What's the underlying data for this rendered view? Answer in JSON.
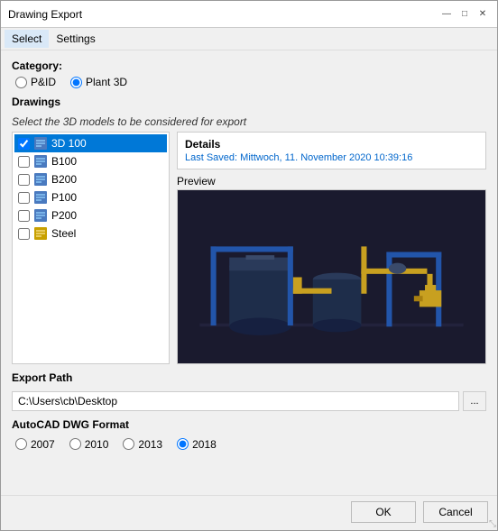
{
  "window": {
    "title": "Drawing Export"
  },
  "titlebar": {
    "minimize": "—",
    "maximize": "□",
    "close": "✕"
  },
  "menu": {
    "items": [
      {
        "label": "Select",
        "active": true
      },
      {
        "label": "Settings",
        "active": false
      }
    ]
  },
  "category": {
    "label": "Category:",
    "options": [
      {
        "label": "P&ID",
        "value": "pid",
        "checked": false
      },
      {
        "label": "Plant 3D",
        "value": "plant3d",
        "checked": true
      }
    ]
  },
  "drawings": {
    "section_label": "Drawings",
    "instruction": "Select the 3D models to be considered for export",
    "files": [
      {
        "name": "3D 100",
        "checked": true,
        "selected": true
      },
      {
        "name": "B100",
        "checked": false,
        "selected": false
      },
      {
        "name": "B200",
        "checked": false,
        "selected": false
      },
      {
        "name": "P100",
        "checked": false,
        "selected": false
      },
      {
        "name": "P200",
        "checked": false,
        "selected": false
      },
      {
        "name": "Steel",
        "checked": false,
        "selected": false
      }
    ],
    "details": {
      "label": "Details",
      "last_saved_text": "Last Saved: Mittwoch, 11. November 2020 10:39:16"
    },
    "preview": {
      "label": "Preview"
    }
  },
  "export": {
    "label": "Export Path",
    "path": "C:\\Users\\cb\\Desktop",
    "browse_label": "..."
  },
  "format": {
    "label": "AutoCAD DWG Format",
    "options": [
      {
        "label": "2007",
        "value": "2007",
        "checked": false
      },
      {
        "label": "2010",
        "value": "2010",
        "checked": false
      },
      {
        "label": "2013",
        "value": "2013",
        "checked": false
      },
      {
        "label": "2018",
        "value": "2018",
        "checked": true
      }
    ]
  },
  "footer": {
    "ok_label": "OK",
    "cancel_label": "Cancel"
  }
}
